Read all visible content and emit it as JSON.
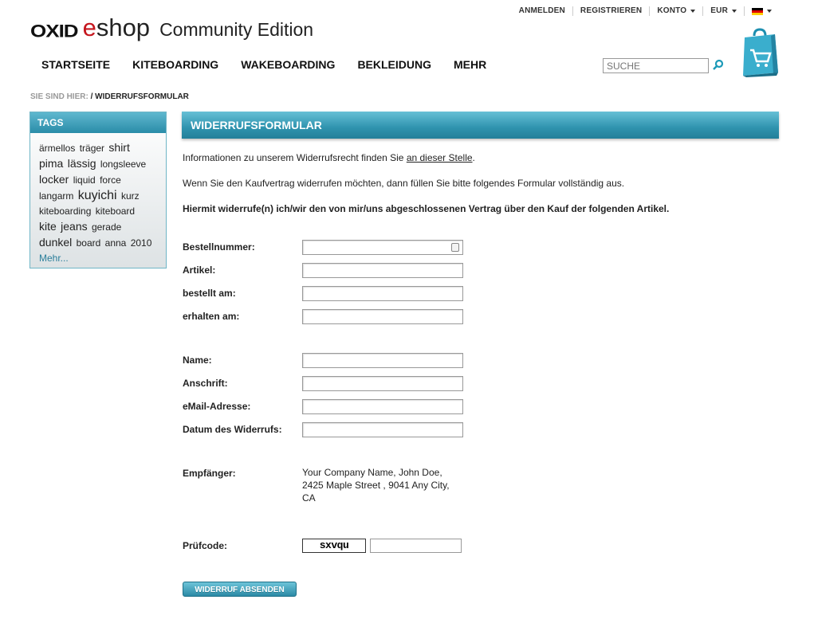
{
  "logo": {
    "oxid": "OXID",
    "e": "e",
    "shop": "shop",
    "edition": "Community Edition"
  },
  "top": {
    "login": "ANMELDEN",
    "register": "REGISTRIEREN",
    "account": "KONTO",
    "currency": "EUR",
    "lang": "flag-de-icon"
  },
  "nav": [
    "STARTSEITE",
    "KITEBOARDING",
    "WAKEBOARDING",
    "BEKLEIDUNG",
    "MEHR"
  ],
  "search": {
    "placeholder": "SUCHE"
  },
  "bc": {
    "label": "SIE SIND HIER:",
    "current": "/ WIDERRUFSFORMULAR"
  },
  "tags": {
    "title": "TAGS",
    "items": [
      {
        "t": "ärmellos",
        "s": "t1"
      },
      {
        "t": "träger",
        "s": "t1"
      },
      {
        "t": "shirt",
        "s": "t2"
      },
      {
        "t": "pima",
        "s": "t2"
      },
      {
        "t": "lässig",
        "s": "t2"
      },
      {
        "t": "longsleeve",
        "s": "t1"
      },
      {
        "t": "locker",
        "s": "t2"
      },
      {
        "t": "liquid",
        "s": "t1"
      },
      {
        "t": "force",
        "s": "t1"
      },
      {
        "t": "langarm",
        "s": "t1"
      },
      {
        "t": "kuyichi",
        "s": "t3"
      },
      {
        "t": "kurz",
        "s": "t1"
      },
      {
        "t": "kiteboarding",
        "s": "t1"
      },
      {
        "t": "kiteboard",
        "s": "t1"
      },
      {
        "t": "kite",
        "s": "t2"
      },
      {
        "t": "jeans",
        "s": "t2"
      },
      {
        "t": "gerade",
        "s": "t1"
      },
      {
        "t": "dunkel",
        "s": "t2"
      },
      {
        "t": "board",
        "s": "t1"
      },
      {
        "t": "anna",
        "s": "t1"
      },
      {
        "t": "2010",
        "s": "t1"
      }
    ],
    "more": "Mehr..."
  },
  "content": {
    "title": "WIDERRUFSFORMULAR",
    "info_pre": "Informationen zu unserem Widerrufsrecht finden Sie ",
    "info_link": "an dieser Stelle",
    "info_post": ".",
    "intro": "Wenn Sie den Kaufvertrag widerrufen möchten, dann füllen Sie bitte folgendes Formular vollständig aus.",
    "statement": "Hiermit widerrufe(n) ich/wir den von mir/uns abgeschlossenen Vertrag über den Kauf der folgenden Artikel."
  },
  "form": {
    "order": "Bestellnummer:",
    "article": "Artikel:",
    "ordered": "bestellt am:",
    "received": "erhalten am:",
    "name": "Name:",
    "address": "Anschrift:",
    "email": "eMail-Adresse:",
    "date": "Datum des Widerrufs:",
    "recipient": "Empfänger:",
    "captcha_label": "Prüfcode:",
    "captcha": "sxvqu",
    "submit": "WIDERRUF ABSENDEN"
  },
  "recipient": {
    "l1": "Your Company Name, John Doe,",
    "l2": "2425 Maple Street , 9041 Any City,",
    "l3": "CA"
  }
}
